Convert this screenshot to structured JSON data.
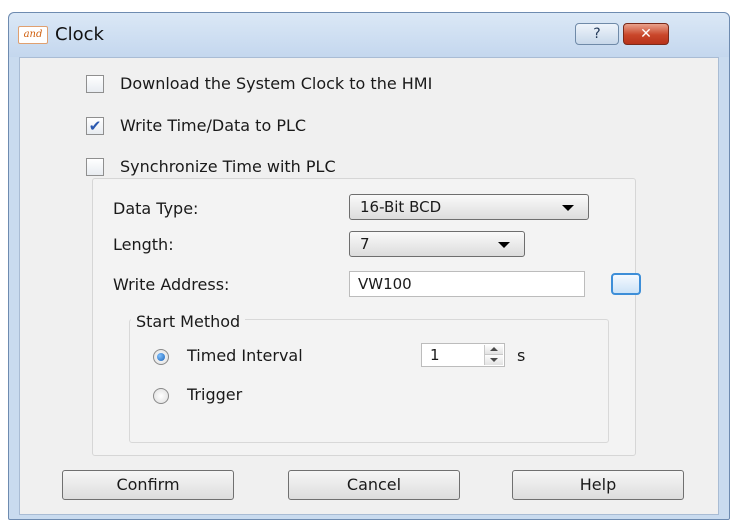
{
  "window": {
    "title": "Clock",
    "app_icon_text": "and",
    "help_glyph": "?",
    "close_glyph": "✕"
  },
  "options": [
    {
      "label": "Download the System Clock to the HMI",
      "checked": false
    },
    {
      "label": "Write Time/Data to PLC",
      "checked": true
    },
    {
      "label": "Synchronize Time with PLC",
      "checked": false
    }
  ],
  "settings": {
    "data_type_label": "Data Type:",
    "data_type_value": "16-Bit BCD",
    "length_label": "Length:",
    "length_value": "7",
    "write_address_label": "Write Address:",
    "write_address_value": "VW100"
  },
  "start_method": {
    "label": "Start Method",
    "timed_interval_label": "Timed Interval",
    "timed_interval_value": "1",
    "timed_interval_unit": "s",
    "trigger_label": "Trigger",
    "selected": "Timed Interval"
  },
  "buttons": {
    "confirm": "Confirm",
    "cancel": "Cancel",
    "help": "Help"
  },
  "colors": {
    "window_frame": "#c9dbef",
    "close_button": "#c9462a",
    "accent_blue": "#3d8ed8"
  }
}
